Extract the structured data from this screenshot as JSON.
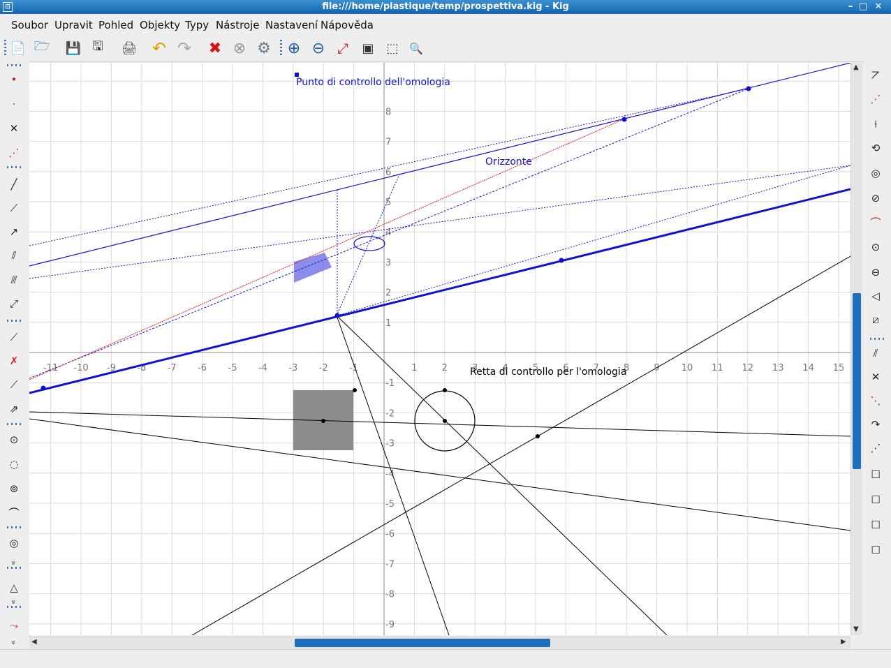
{
  "window": {
    "title": "file:///home/plastique/temp/prospettiva.kig - Kig",
    "controls": {
      "minimize": "–",
      "maximize": "□",
      "close": "✕"
    }
  },
  "menu": [
    {
      "label": "Soubor"
    },
    {
      "label": "Upravit"
    },
    {
      "label": "Pohled"
    },
    {
      "label": "Objekty"
    },
    {
      "label": "Typy"
    },
    {
      "label": "Nástroje"
    },
    {
      "label": "Nastavení"
    },
    {
      "label": "Nápověda"
    }
  ],
  "toolbar": [
    {
      "name": "new-document-icon",
      "glyph": "📄"
    },
    {
      "name": "open-document-icon",
      "glyph": "🗁"
    },
    {
      "name": "save-icon",
      "glyph": "💾"
    },
    {
      "name": "save-as-icon",
      "glyph": "🖫"
    },
    {
      "name": "print-icon",
      "glyph": "🖨"
    },
    {
      "name": "undo-icon",
      "glyph": "↶"
    },
    {
      "name": "redo-icon",
      "glyph": "↷"
    },
    {
      "name": "delete-objects-icon",
      "glyph": "✖"
    },
    {
      "name": "cancel-construction-icon",
      "glyph": "⊗"
    },
    {
      "name": "settings-gear-icon",
      "glyph": "⚙"
    },
    {
      "name": "zoom-in-icon",
      "glyph": "⊕"
    },
    {
      "name": "zoom-out-icon",
      "glyph": "⊖"
    },
    {
      "name": "zoom-fit-icon",
      "glyph": "⤢"
    },
    {
      "name": "view-fullscreen-icon",
      "glyph": "▣"
    },
    {
      "name": "select-shown-area-icon",
      "glyph": "⬚"
    },
    {
      "name": "zoom-area-icon",
      "glyph": "🔍"
    }
  ],
  "colors": {
    "grid": "#d9d9d9",
    "axis": "#888888",
    "tick_label": "#777777",
    "blue": "#1010d0",
    "red": "#e02020",
    "black": "#000000",
    "polygon_fill": "#7878e8",
    "square_fill": "#8c8c8c",
    "accent": "#1f6fbf"
  },
  "canvas": {
    "x_ticks": [
      "12",
      "-11",
      "-10",
      "-9",
      "-8",
      "-7",
      "-6",
      "-5",
      "-4",
      "-3",
      "-2",
      "-1",
      "1",
      "2",
      "3",
      "4",
      "5",
      "6",
      "7",
      "8",
      "9",
      "10",
      "11",
      "12",
      "13",
      "14",
      "15"
    ],
    "y_ticks": [
      "8",
      "7",
      "6",
      "5",
      "4",
      "3",
      "2",
      "1",
      "-1",
      "-2",
      "-3",
      "-4",
      "-5",
      "-6",
      "-7",
      "-8",
      "-9"
    ],
    "labels": {
      "control_point": "Punto di controllo dell'omologia",
      "horizon": "Orizzonte",
      "control_line": "Retta di controllo per l'omologia"
    }
  }
}
